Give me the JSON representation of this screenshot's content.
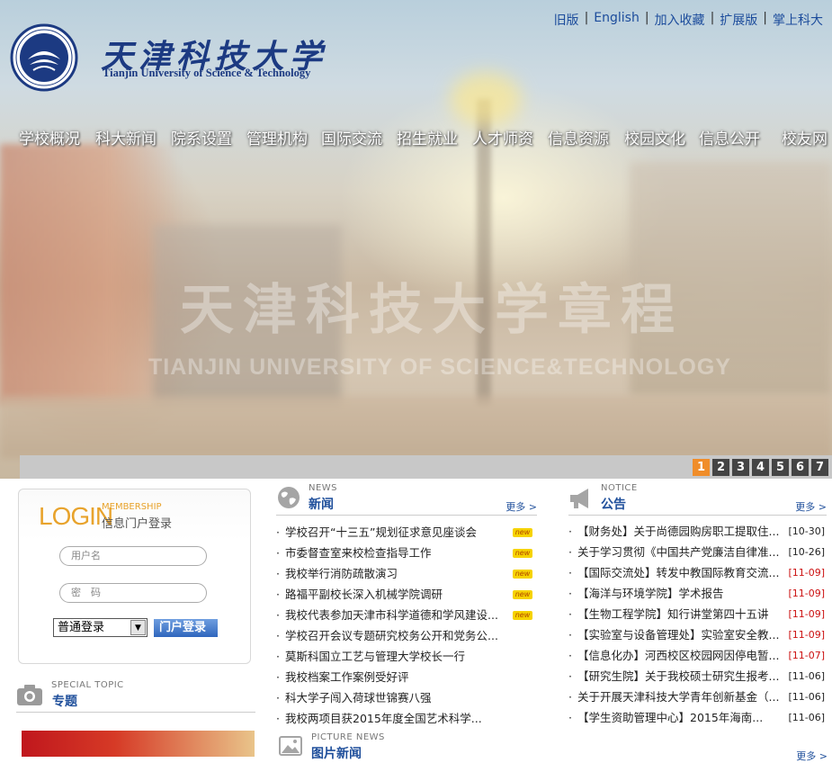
{
  "header": {
    "logo_cn": "天津科技大学",
    "logo_en": "Tianjin University of Science & Technology",
    "top_links": [
      "旧版",
      "English",
      "加入收藏",
      "扩展版",
      "掌上科大"
    ]
  },
  "nav": {
    "items": [
      "学校概况",
      "科大新闻",
      "院系设置",
      "管理机构",
      "国际交流",
      "招生就业",
      "人才师资",
      "信息资源",
      "校园文化",
      "信息公开",
      "校友网"
    ]
  },
  "banner": {
    "watermark_cn": "天津科技大学章程",
    "watermark_en": "TIANJIN UNIVERSITY OF SCIENCE&TECHNOLOGY",
    "slides": [
      "1",
      "2",
      "3",
      "4",
      "5",
      "6",
      "7"
    ],
    "active_slide": 1
  },
  "login": {
    "title": "LOGIN",
    "membership": "MEMBERSHIP",
    "subtitle": "信息门户登录",
    "username_placeholder": "用户名",
    "password_placeholder": "密　码",
    "login_type": "普通登录",
    "button": "门户登录"
  },
  "special": {
    "en": "SPECIAL TOPIC",
    "cn": "专题"
  },
  "news": {
    "en": "NEWS",
    "cn": "新闻",
    "more": "更多 >",
    "new_label": "new",
    "items": [
      {
        "title": "学校召开“十三五”规划征求意见座谈会",
        "new": true
      },
      {
        "title": "市委督查室来校检查指导工作",
        "new": true
      },
      {
        "title": "我校举行消防疏散演习",
        "new": true
      },
      {
        "title": "路福平副校长深入机械学院调研",
        "new": true
      },
      {
        "title": "我校代表参加天津市科学道德和学风建设...",
        "new": true
      },
      {
        "title": "学校召开会议专题研究校务公开和党务公...",
        "new": false
      },
      {
        "title": "莫斯科国立工艺与管理大学校长一行",
        "new": false
      },
      {
        "title": "我校档案工作案例受好评",
        "new": false
      },
      {
        "title": "科大学子闯入荷球世锦赛八强",
        "new": false
      },
      {
        "title": "我校两项目获2015年度全国艺术科学...",
        "new": false
      }
    ]
  },
  "notice": {
    "en": "NOTICE",
    "cn": "公告",
    "more": "更多 >",
    "items": [
      {
        "title": "【财务处】关于尚德园购房职工提取住...",
        "date": "[10-30]",
        "red": false
      },
      {
        "title": "关于学习贯彻《中国共产党廉洁自律准...",
        "date": "[10-26]",
        "red": false
      },
      {
        "title": "【国际交流处】转发中教国际教育交流...",
        "date": "[11-09]",
        "red": true
      },
      {
        "title": "【海洋与环境学院】学术报告",
        "date": "[11-09]",
        "red": true
      },
      {
        "title": "【生物工程学院】知行讲堂第四十五讲",
        "date": "[11-09]",
        "red": true
      },
      {
        "title": "【实验室与设备管理处】实验室安全教...",
        "date": "[11-09]",
        "red": true
      },
      {
        "title": "【信息化办】河西校区校园网因停电暂...",
        "date": "[11-07]",
        "red": true
      },
      {
        "title": "【研究生院】关于我校硕士研究生报考...",
        "date": "[11-06]",
        "red": false
      },
      {
        "title": "关于开展天津科技大学青年创新基金（...",
        "date": "[11-06]",
        "red": false
      },
      {
        "title": "【学生资助管理中心】2015年海南...",
        "date": "[11-06]",
        "red": false
      }
    ]
  },
  "picture_news": {
    "en": "PICTURE NEWS",
    "cn": "图片新闻",
    "more": "更多 >"
  }
}
